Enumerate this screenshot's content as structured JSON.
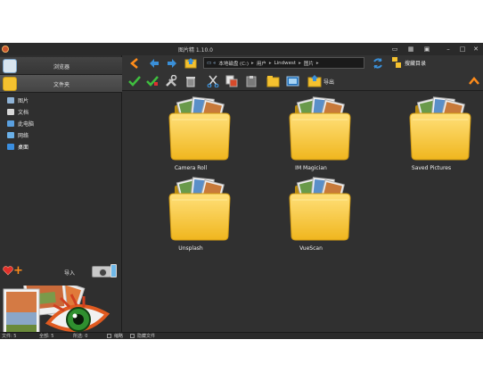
{
  "window": {
    "title": "图片精 1.10.0",
    "controls": {
      "minimize": "–",
      "maximize": "□",
      "close": "✕"
    }
  },
  "sidebar": {
    "browse_label": "浏览器",
    "folders_label": "文件夹",
    "tree": [
      {
        "label": "图片",
        "icon_color": "#8fb3d6"
      },
      {
        "label": "文档",
        "icon_color": "#d8d8d8"
      },
      {
        "label": "此电脑",
        "icon_color": "#5aa0e0"
      },
      {
        "label": "网络",
        "icon_color": "#6ab0e8"
      },
      {
        "label": "桌面",
        "icon_color": "#3a8ee0"
      }
    ],
    "import_label": "导入"
  },
  "toolbar": {
    "address_segments": [
      "本地磁盘 (C:)",
      "用户",
      "Lindwest",
      "图片"
    ],
    "recent_label": "搜藏目录",
    "export_label": "导出"
  },
  "content": {
    "folders": [
      {
        "name": "Camera Roll"
      },
      {
        "name": "IM Magician"
      },
      {
        "name": "Saved Pictures"
      },
      {
        "name": "Unsplash"
      },
      {
        "name": "VueScan"
      }
    ]
  },
  "status": {
    "items": [
      "文件: 5",
      "全部: 5",
      "所选: 0",
      "缩略",
      "隐藏文件"
    ]
  },
  "colors": {
    "accent_orange": "#ff8c1a",
    "check_green": "#3fbf3f",
    "nav_blue": "#3a8fd8",
    "folder_yellow": "#f4c12f"
  }
}
